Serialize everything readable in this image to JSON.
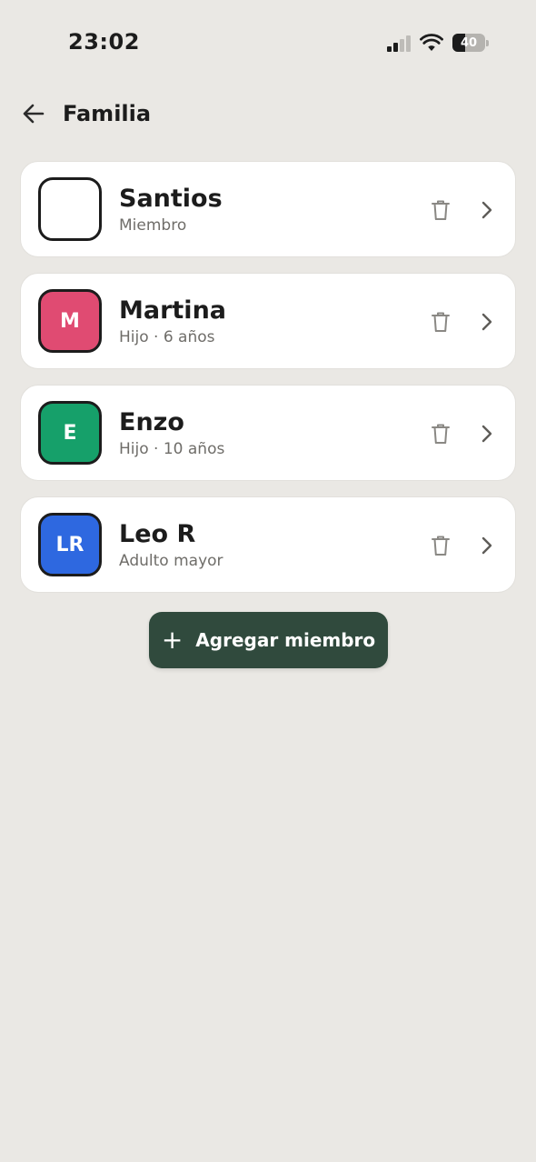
{
  "status_bar": {
    "time": "23:02",
    "battery": "40"
  },
  "header": {
    "title": "Familia"
  },
  "members": [
    {
      "name": "Santios",
      "subtitle": "Miembro",
      "initials": "",
      "color": "#FFFFFF"
    },
    {
      "name": "Martina",
      "subtitle": "Hijo · 6 años",
      "initials": "M",
      "color": "#E04B72"
    },
    {
      "name": "Enzo",
      "subtitle": "Hijo · 10 años",
      "initials": "E",
      "color": "#16A06A"
    },
    {
      "name": "Leo R",
      "subtitle": "Adulto mayor",
      "initials": "LR",
      "color": "#2E68E0"
    }
  ],
  "add_button": {
    "label": "Agregar miembro"
  },
  "icons": {
    "back": "arrow-left-icon",
    "delete": "trash-icon",
    "open": "chevron-right-icon",
    "add": "plus-icon"
  },
  "colors": {
    "background": "#EAE8E4",
    "card": "#FFFFFF",
    "primary_button": "#304A3D"
  }
}
